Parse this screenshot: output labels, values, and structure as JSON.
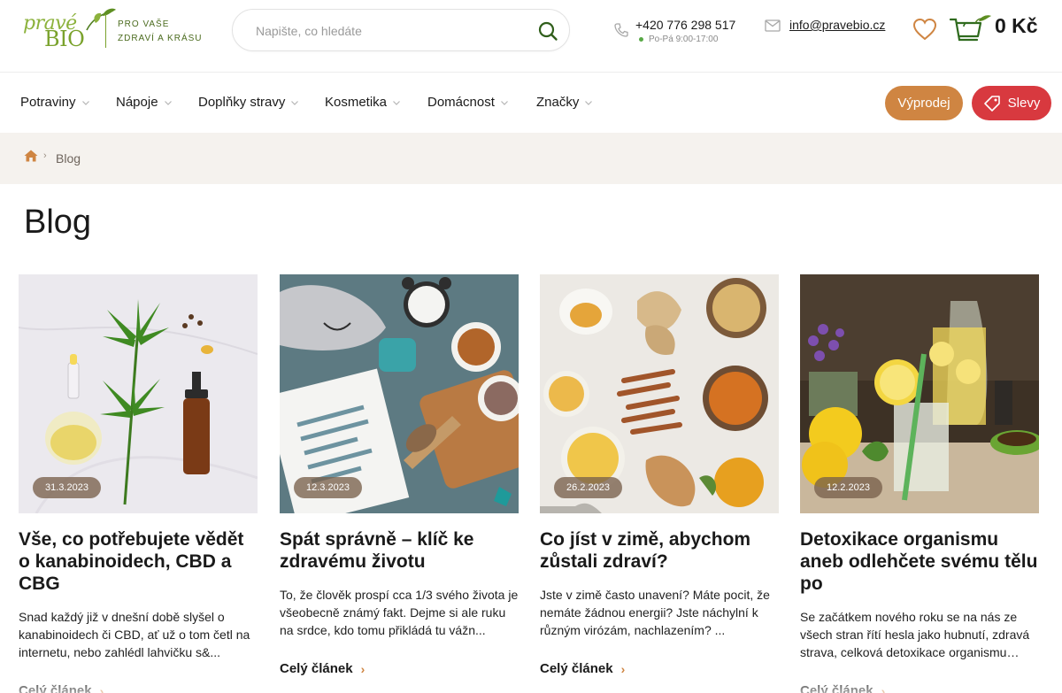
{
  "header": {
    "logo_text_a": "pravé",
    "logo_text_b": "BIO",
    "tagline_line1": "PRO VAŠE",
    "tagline_line2": "ZDRAVÍ A KRÁSU",
    "search_placeholder": "Napište, co hledáte",
    "search_icon": "search-icon",
    "phone": "+420 776 298 517",
    "hours": "Po-Pá 9:00-17:00",
    "email": "info@pravebio.cz",
    "cart_total": "0 Kč",
    "colors": {
      "brand_green": "#7aa22c",
      "accent_orange": "#cf8542",
      "accent_red": "#d8393f"
    }
  },
  "nav": {
    "items": [
      {
        "label": "Potraviny"
      },
      {
        "label": "Nápoje"
      },
      {
        "label": "Doplňky stravy"
      },
      {
        "label": "Kosmetika"
      },
      {
        "label": "Domácnost"
      },
      {
        "label": "Značky"
      }
    ],
    "sale_button": "Výprodej",
    "deals_button": "Slevy"
  },
  "breadcrumb": {
    "home_icon": "home-icon",
    "current": "Blog"
  },
  "page": {
    "title": "Blog"
  },
  "articles": [
    {
      "date": "31.3.2023",
      "title": "Vše, co potřebujete vědět o kanabinoidech, CBD a CBG",
      "excerpt": "Snad každý již v dnešní době slyšel o kanabinoidech či CBD, ať už o tom četl na internetu, nebo zahlédl lahvičku s&...",
      "link": "Celý článek"
    },
    {
      "date": "12.3.2023",
      "title": "Spát správně – klíč ke zdravému životu",
      "excerpt": "To, že člověk prospí cca 1/3 svého života je všeobecně známý fakt. Dejme si ale ruku na srdce, kdo tomu přikládá tu vážn...",
      "link": "Celý článek"
    },
    {
      "date": "26.2.2023",
      "title": "Co jíst v zimě, abychom zůstali zdraví?",
      "excerpt": "Jste v zimě často unavení? Máte pocit, že nemáte žádnou energii? Jste náchylní k různým virózám, nachlazením? ...",
      "link": "Celý článek"
    },
    {
      "date": "12.2.2023",
      "title": "Detoxikace organismu aneb odlehčete svému tělu po",
      "excerpt": "Se začátkem nového roku se na nás ze všech stran řítí hesla jako hubnutí, zdravá strava, celková detoxikace organismu… P...",
      "link": "Celý článek"
    }
  ]
}
